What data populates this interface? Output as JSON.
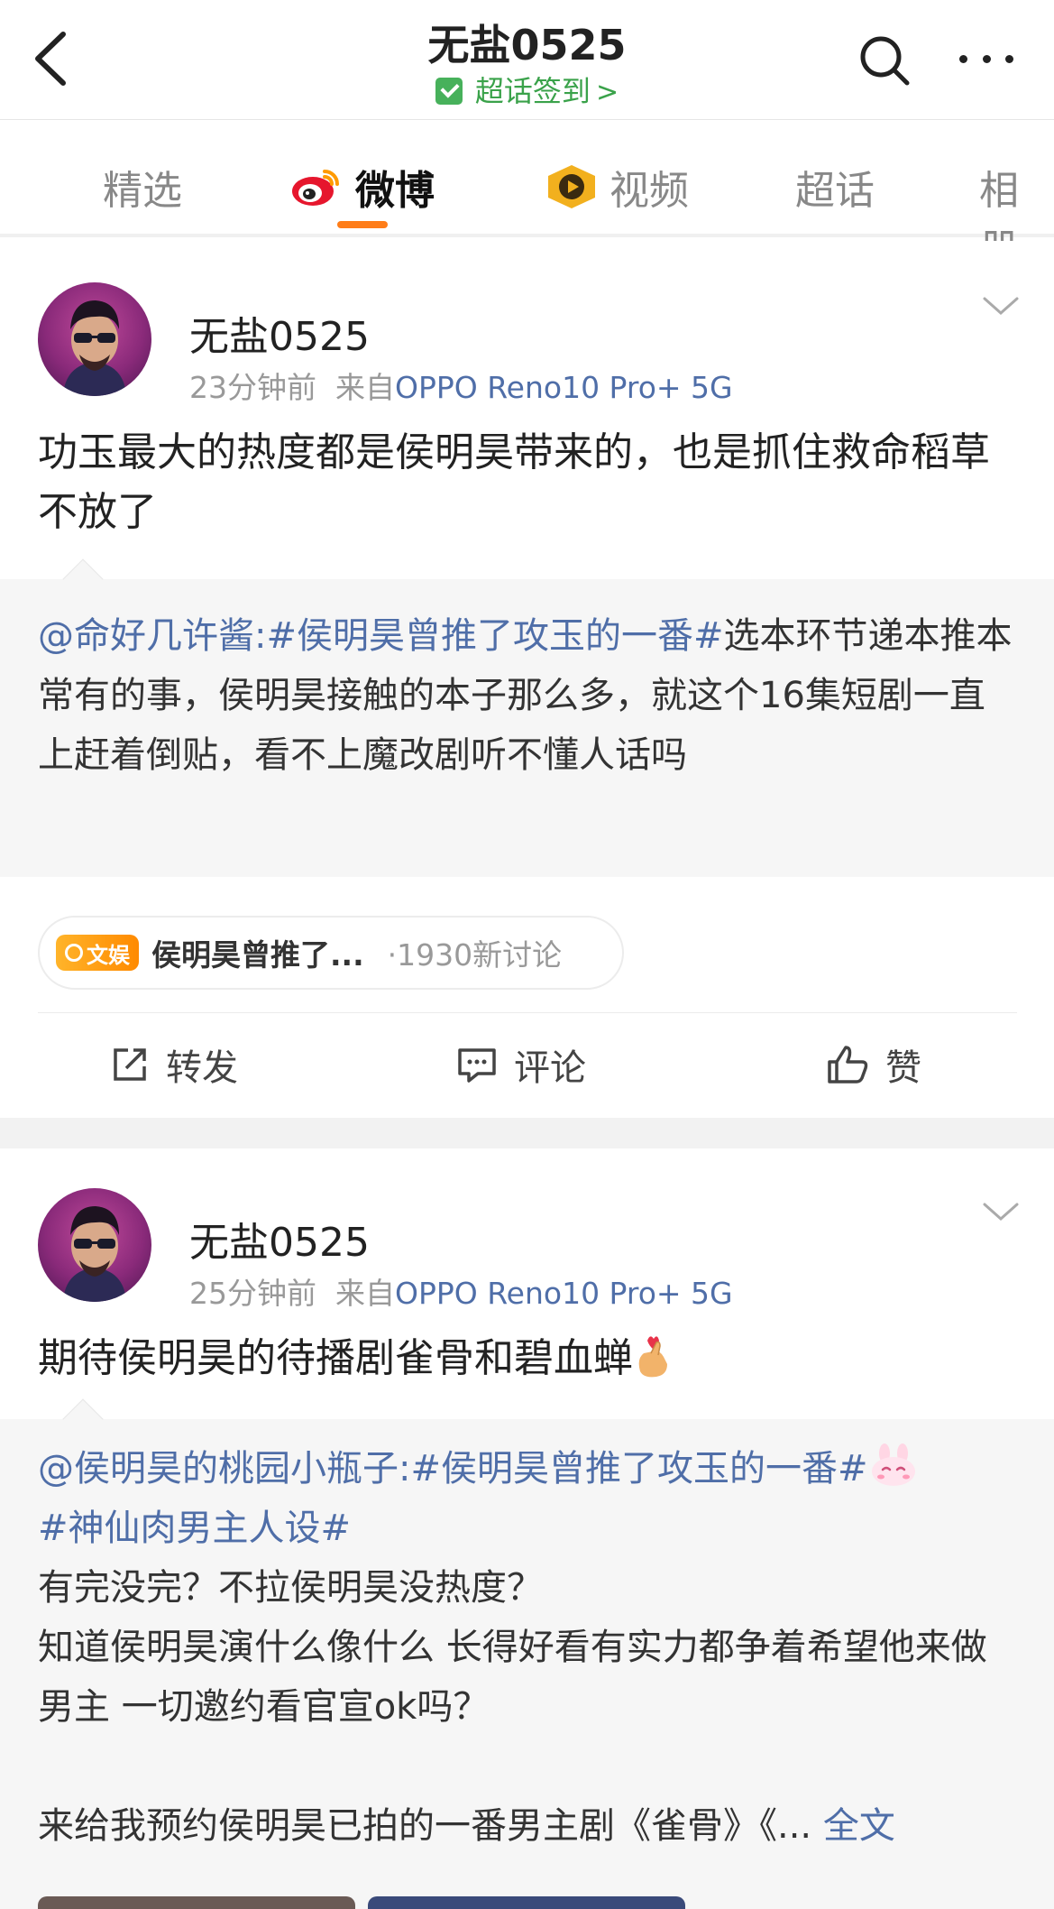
{
  "header": {
    "title": "无盐0525",
    "checkin_label": "超话签到",
    "checkin_chevron": ">"
  },
  "tabs": [
    {
      "label": "精选"
    },
    {
      "label": "微博"
    },
    {
      "label": "视频"
    },
    {
      "label": "超话"
    },
    {
      "label": "相册"
    }
  ],
  "active_tab": "微博",
  "colors": {
    "accent": "#ff7d18",
    "link": "#4f6ea8",
    "checkin": "#3aa24a"
  },
  "posts": [
    {
      "user": "无盐0525",
      "time": "23分钟前",
      "source_prefix": "来自",
      "device": "OPPO Reno10 Pro+ 5G",
      "text": "功玉最大的热度都是侯明昊带来的，也是抓住救命稻草不放了",
      "repost": {
        "mention": "@命好几许酱:",
        "topic": "#侯明昊曾推了攻玉的一番#",
        "body": "选本环节递本推本常有的事，侯明昊接触的本子那么多，就这个16集短剧一直上赶着倒贴，看不上魔改剧听不懂人话吗"
      },
      "topic_card": {
        "badge": "文娱",
        "name": "侯明昊曾推了...",
        "count": "·1930新讨论"
      },
      "actions": {
        "repost": "转发",
        "comment": "评论",
        "like": "赞"
      }
    },
    {
      "user": "无盐0525",
      "time": "25分钟前",
      "source_prefix": "来自",
      "device": "OPPO Reno10 Pro+ 5G",
      "text": "期待侯明昊的待播剧雀骨和碧血蝉",
      "repost": {
        "mention": "@侯明昊的桃园小瓶子:",
        "topic": "#侯明昊曾推了攻玉的一番#",
        "topic2": "#神仙肉男主人设#",
        "line1": "有完没完？不拉侯明昊没热度？",
        "line2": "知道侯明昊演什么像什么 长得好看有实力都争着希望他来做男主 一切邀约看官宣ok吗？",
        "line3": "来给我预约侯明昊已拍的一番男主剧《雀骨》《...",
        "fulltext": "全文"
      }
    }
  ]
}
